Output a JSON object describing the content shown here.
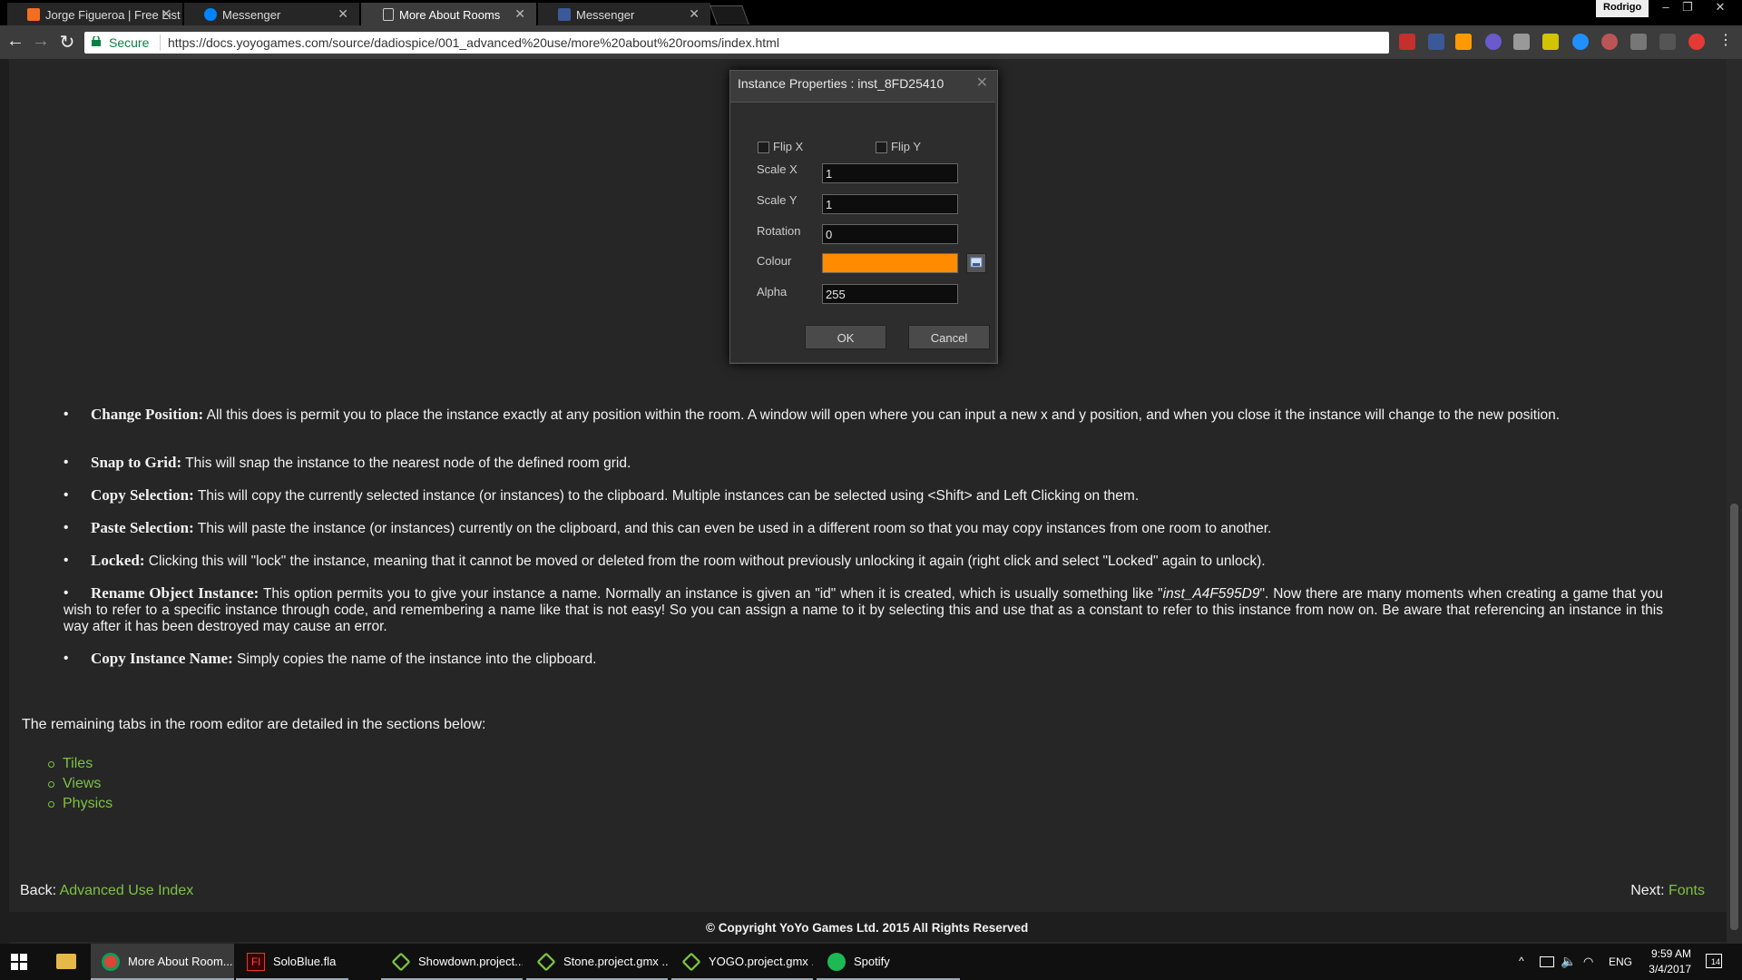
{
  "browser": {
    "tabs": [
      {
        "title": "Jorge Figueroa | Free List",
        "icon": "soundcloud-icon",
        "color": "#f26f21"
      },
      {
        "title": "Messenger",
        "icon": "messenger-icon",
        "color": "#0084ff"
      },
      {
        "title": "More About Rooms",
        "icon": "page-icon",
        "color": "#cccccc"
      },
      {
        "title": "Messenger",
        "icon": "facebook-icon",
        "color": "#3b5998"
      }
    ],
    "close_glyph": "✕",
    "profile": "Rodrigo",
    "window_controls": {
      "minimize": "–",
      "restore": "❐",
      "close": "✕"
    },
    "secure_label": "Secure",
    "url": "https://docs.yoyogames.com/source/dadiospice/001_advanced%20use/more%20about%20rooms/index.html"
  },
  "dialog": {
    "title": "Instance Properties : inst_8FD25410",
    "close_glyph": "✕",
    "flip_x": "Flip X",
    "flip_y": "Flip Y",
    "scale_x_label": "Scale X",
    "scale_x": "1",
    "scale_y_label": "Scale Y",
    "scale_y": "1",
    "rotation_label": "Rotation",
    "rotation": "0",
    "colour_label": "Colour",
    "colour": "#ff8c00",
    "alpha_label": "Alpha",
    "alpha": "255",
    "ok": "OK",
    "cancel": "Cancel"
  },
  "content": {
    "bullets": [
      {
        "title": "Change Position:",
        "text": " All this does is permit you to place the instance exactly at any position within the room. A window will open where you can input a new x and y position, and when you close it the instance will change to the new position."
      },
      {
        "title": "Snap to Grid:",
        "text": " This will snap the instance to the nearest node of the defined room grid."
      },
      {
        "title": "Copy Selection:",
        "text": " This will copy the currently selected instance (or instances) to the clipboard. Multiple instances can be selected using <Shift> and Left Clicking on them."
      },
      {
        "title": "Paste Selection:",
        "text": " This will paste the instance (or instances) currently on the clipboard, and this can even be used in a different room so that you may copy instances from one room to another."
      },
      {
        "title": "Locked:",
        "text": " Clicking this will \"lock\" the instance, meaning that it cannot be moved or deleted from the room without previously unlocking it again (right click and select \"Locked\" again to unlock)."
      },
      {
        "title": "Rename Object Instance:",
        "text_pre": " This option permits you to give your instance a name. Normally an instance is given an \"id\" when it is created, which is usually something like \"",
        "italic": "inst_A4F595D9",
        "text_post": "\". Now there are many moments when creating a game that you wish to refer to a specific instance through code, and remembering a name like that is not easy! So you can assign a name to it by selecting this and use that as a constant to refer to this instance from now on. Be aware that referencing an instance in this way after it has been destroyed may cause an error."
      },
      {
        "title": "Copy Instance Name:",
        "text": " Simply copies the name of the instance into the clipboard."
      }
    ],
    "remaining": "The remaining tabs in the room editor are detailed in the sections below:",
    "sections": [
      "Tiles",
      "Views",
      "Physics"
    ],
    "back_label": "Back:",
    "back_link": "Advanced Use Index",
    "next_label": "Next:",
    "next_link": "Fonts",
    "copyright": "© Copyright YoYo Games Ltd. 2015 All Rights Reserved"
  },
  "taskbar": {
    "items": [
      {
        "label": "More About Room...",
        "icon": "chrome-icon"
      },
      {
        "label": "SoloBlue.fla",
        "icon": "flash-icon",
        "icon_text": "Fl"
      },
      {
        "label": "Showdown.project....",
        "icon": "gamemaker-icon"
      },
      {
        "label": "Stone.project.gmx ...",
        "icon": "gamemaker-icon"
      },
      {
        "label": "YOGO.project.gmx ...",
        "icon": "gamemaker-icon"
      },
      {
        "label": "Spotify",
        "icon": "spotify-icon"
      }
    ],
    "language": "ENG",
    "time": "9:59 AM",
    "date": "3/4/2017",
    "notifications": "14"
  }
}
